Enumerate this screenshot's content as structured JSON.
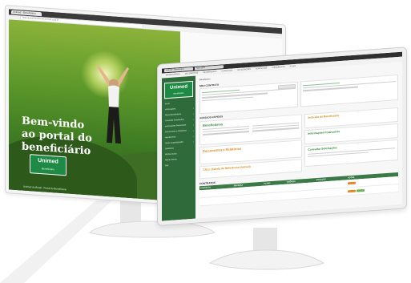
{
  "left_monitor": {
    "browser_tab": "Unimed - Beneficiário",
    "address": "https://portal.beneficiario.unimed.coop.br",
    "hero_title_lines": [
      "Bem-vindo",
      "ao portal do",
      "beneficiário"
    ],
    "logo_text": "Unimed",
    "logo_sub": "Beneficiário",
    "footer_text": "Unimed do Brasil - Portal do Beneficiário"
  },
  "right_monitor": {
    "browser_tabs": [
      "Unimed - Beneficiário",
      "Nova guia"
    ],
    "nav_items": [
      "BENEFICIÁRIOS",
      "DOCUMENTOS",
      "INFORMAÇÕES",
      "CONSULTAS",
      "SOLICITAÇÕES",
      "CONTRATOS",
      "ATENDIMENTO",
      "AJUDA"
    ],
    "brand": "Unimed",
    "brand_sub": "Beneficiário",
    "sidebar_items": [
      {
        "label": "Início",
        "chev": ""
      },
      {
        "label": "Informações",
        "chev": "›"
      },
      {
        "label": "Meus Beneficiários",
        "chev": "›"
      },
      {
        "label": "Consultar Solicitações",
        "chev": "›"
      },
      {
        "label": "Informações Financeiras",
        "chev": "›"
      },
      {
        "label": "Documentos e Relatórios",
        "chev": "›"
      },
      {
        "label": "Atendimento",
        "chev": "›"
      },
      {
        "label": "Gerar Coparticipação",
        "chev": "›"
      },
      {
        "label": "Relatórios",
        "chev": ""
      },
      {
        "label": "Minhas Guias",
        "chev": ""
      },
      {
        "label": "Alterar Senha",
        "chev": ""
      },
      {
        "label": "Sair",
        "chev": ""
      }
    ],
    "topbar": "Beneficiário",
    "section_contract": "MEU CONTRATO",
    "section_shortcuts": "ACESSOS RÁPIDOS",
    "tiles": {
      "beneficiarios": "Beneficiários",
      "inclusao": "Inclusão de Beneficiário",
      "financeiras": "Informações Financeiras",
      "documentos": "Documentos e Relatórios",
      "tru": "T.R.U. (Tabela de Referência Unimed)",
      "consultar": "Consultar Solicitações"
    },
    "contracts_title": "CONTRATOS",
    "table_headers": [
      "CONTRATO",
      "EMPRESA",
      "PLANO",
      "VIGÊNCIA",
      "SITUAÇÃO",
      "AÇÕES"
    ],
    "table_rows": [
      {
        "c1": "",
        "c2": "",
        "c3": "",
        "c4": "",
        "c5": "",
        "status": "o"
      },
      {
        "c1": "",
        "c2": "",
        "c3": "",
        "c4": "",
        "c5": "",
        "status": "g"
      }
    ]
  }
}
